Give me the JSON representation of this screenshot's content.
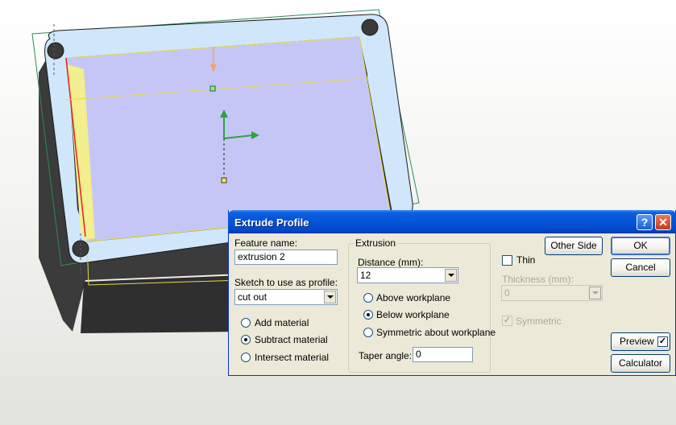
{
  "dialog": {
    "title": "Extrude Profile",
    "feature_name_label": "Feature name:",
    "feature_name_value": "extrusion 2",
    "sketch_label": "Sketch to use as profile:",
    "sketch_value": "cut out",
    "operation_options": [
      {
        "label": "Add material",
        "selected": false
      },
      {
        "label": "Subtract material",
        "selected": true
      },
      {
        "label": "Intersect material",
        "selected": false
      }
    ],
    "extrusion_group_label": "Extrusion",
    "distance_label": "Distance (mm):",
    "distance_value": "12",
    "direction_options": [
      {
        "label": "Above workplane",
        "selected": false
      },
      {
        "label": "Below workplane",
        "selected": true
      },
      {
        "label": "Symmetric about workplane",
        "selected": false
      }
    ],
    "taper_label": "Taper angle:",
    "taper_value": "0",
    "other_side_label": "Other Side",
    "thin_label": "Thin",
    "thin_checked": false,
    "thickness_label": "Thickness (mm):",
    "thickness_value": "0",
    "symmetric_label": "Symmetric",
    "symmetric_checked": true,
    "ok_label": "OK",
    "cancel_label": "Cancel",
    "preview_label": "Preview",
    "preview_checked": true,
    "calculator_label": "Calculator",
    "help_glyph": "?",
    "close_glyph": "✕"
  },
  "colors": {
    "titlebar": "#0553d8",
    "dialog_bg": "#ece9d8",
    "model_frame": "#cce4fb",
    "model_body": "#3a3a3a",
    "sketch_face": "#c8c8f8",
    "edge_highlight": "#f5f08c",
    "axis_green": "#2ea043",
    "arrow_orange": "#f4a460"
  },
  "icons": [
    "help-icon",
    "close-icon",
    "dropdown-arrow-icon",
    "axis-triad-icon",
    "extrude-direction-arrow-icon"
  ]
}
